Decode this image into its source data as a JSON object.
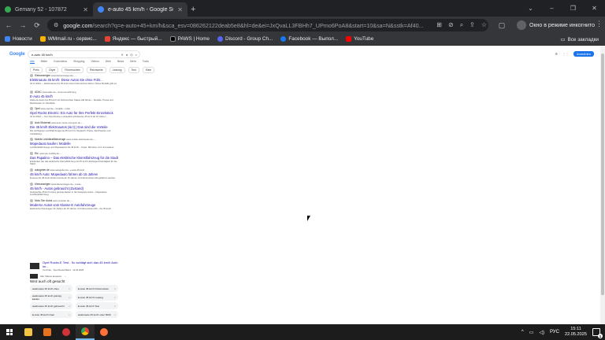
{
  "tabs": [
    {
      "title": "Gemany 52 - 107872",
      "favicon_color": "#34a853",
      "active": false
    },
    {
      "title": "e-auto 45 km/h - Google Suche",
      "favicon_color": "#4285f4",
      "active": true
    }
  ],
  "window_controls": {
    "minimize": "–",
    "maximize": "❐",
    "close": "✕",
    "tab_search": "⌄"
  },
  "toolbar": {
    "back": "←",
    "forward": "→",
    "reload": "⟳",
    "url_domain": "google.com",
    "url_rest": "/search?q=e-auto+45+km/h&sca_esv=086262122deab5e8&hl=de&ei=JxQvaLL3FBHh7_UPmo6PoA8&start=10&sa=N&sstk=Af40...",
    "incognito_label": "Окно в режиме инкогнито"
  },
  "bookmarks": [
    {
      "label": "Новости",
      "color": "#4285f4"
    },
    {
      "label": "WMmail.ru - сервис...",
      "color": "#f4b400"
    },
    {
      "label": "Яндекс — быстрый...",
      "color": "#ea4335"
    },
    {
      "label": "PAWS | Home",
      "color": "#000000"
    },
    {
      "label": "Discord - Group Ch...",
      "color": "#5865f2"
    },
    {
      "label": "Facebook — Выпол...",
      "color": "#1877f2"
    },
    {
      "label": "YouTube",
      "color": "#ff0000"
    }
  ],
  "all_bookmarks": "Все закладки",
  "google": {
    "logo": "Google",
    "query": "e-auto 45 km/h",
    "nav_tabs": [
      "Alle",
      "Bilder",
      "Kurzvideos",
      "Shopping",
      "Videos",
      "Web",
      "News",
      "Mehr",
      "Tools"
    ],
    "filters": [
      "Preis",
      "Cityel",
      "Führerschein",
      "Reichweite",
      "Leasing",
      "Test",
      "Klein"
    ],
    "signin": "Anmelden",
    "results": [
      {
        "site": "Kleinanzeigen",
        "url": "www.kleinanzeigen.de › ...",
        "title": "Elektroauto 45 km/h: Diese Autos Sie ohne Führ...",
        "snippet": "01.11.2024 — Elektroautos bis 45 km/h ohne Führerschein fahren: Diese Modelle gibt es ..."
      },
      {
        "site": "ADAC",
        "url": "www.adac.de › rund-ums-fahrzeug",
        "title": "E-Auto 45 km/h",
        "snippet": "Kleine E-Autos bis 45 km/h mit Führerschein Klasse AM fahren – Modelle, Preise und Reichweiten im Überblick."
      },
      {
        "site": "Opel",
        "url": "www.opel.de › modelle › rocks",
        "title": "Opel Rocks Electric: Ein Auto für Ihre Perfekt Einzelstück",
        "snippet": "01.12.2024 — Der Opel Rocks-e schaukelt schrittweise 45 km/h ab 15 Jahren ..."
      },
      {
        "site": "Auto Motorrad",
        "url": "www.auto-motor-und-sport.de › ...",
        "title": "Die 45 km/h Elektroautos (sic!) | Das sind die Vorteile",
        "snippet": "Die wichtigsten Leichtfahrzeuge bis 45 km/h im Vergleich: Preise, Reichweiten und Ausstattung."
      },
      {
        "site": "Mobile Leichtkraftfahrzeuge",
        "url": "www.mobile-elektroauto.de › ...",
        "title": "Mopedauto kaufen: Modelle",
        "snippet": "Leichtkraftfahrzeuge und Mopedautos bis 45 km/h – Cityel, Microlino, Ami und weitere."
      },
      {
        "site": "Etc.",
        "url": "www.etc-mobility.de › ...",
        "title": "Das Papalino – Das elektrische Kleinstfahrzeug für die Stadt",
        "snippet": "Entdecken Sie das elektrische Kleinstfahrzeug mit 45 km/h Höchstgeschwindigkeit für die Stadt."
      },
      {
        "site": "autogeber.de",
        "url": "www.autogeber.de › e-auto-45-kmh",
        "title": "45 km/h Auto: Mopedauto fahren ab 15 Jahren",
        "snippet": "E-Autos bis 45 km/h dürfen bereits ab 15 Jahren mit Führerschein AM gefahren werden."
      },
      {
        "site": "Kleinanzeigen",
        "url": "www.kleinanzeigen.de › s-auto",
        "title": "45 km/h - Autos gebraucht (Zustand)",
        "snippet": "Gebrauchte 45 km/h Autos günstig kaufen in der Kategorie Autos – Mopedauto, Leichtkraftfahrzeug."
      },
      {
        "site": "Moto Tarr Autos",
        "url": "www.mototarr.de › ...",
        "title": "Moderne Autos vom Klasse-E Autofahrzeuge",
        "snippet": "Elektrische Kleinwagen für Fahrer ab 15 Jahren mit Führerschein AM – bis 45 km/h."
      }
    ],
    "video": {
      "title": "Opel Rocks-E Test - So schlägt sich das 45 km/h Auto im...",
      "meta": "YouTube · Opel Deutschland · 12.04.2025"
    },
    "more_videos": "Alle Videos ansehen",
    "also_searched_title": "Wird auch oft gesucht",
    "also_searched": [
      "elektroauto 45 km/h ohne",
      "E-Auto 45 km/h Führerschein",
      "elektroauto 45 km/h günstig kaufen",
      "E-Auto 45 km/h Leasing",
      "elektroauto 45 km/h gebraucht",
      "E-Auto 45 km/h Test",
      "E-Auto 45 km/h Opel",
      "elektroauto 45 km/h unter 5000"
    ]
  },
  "taskbar": {
    "apps": [
      {
        "name": "file-explorer",
        "color": "#f4c542"
      },
      {
        "name": "mail",
        "color": "#e8731c"
      },
      {
        "name": "paint",
        "color": "#d13438"
      },
      {
        "name": "chrome",
        "color": "#34a853"
      },
      {
        "name": "firefox",
        "color": "#ff7139"
      }
    ],
    "language": "РУС",
    "time": "15:11",
    "date": "22.05.2025",
    "notifications": "1"
  }
}
